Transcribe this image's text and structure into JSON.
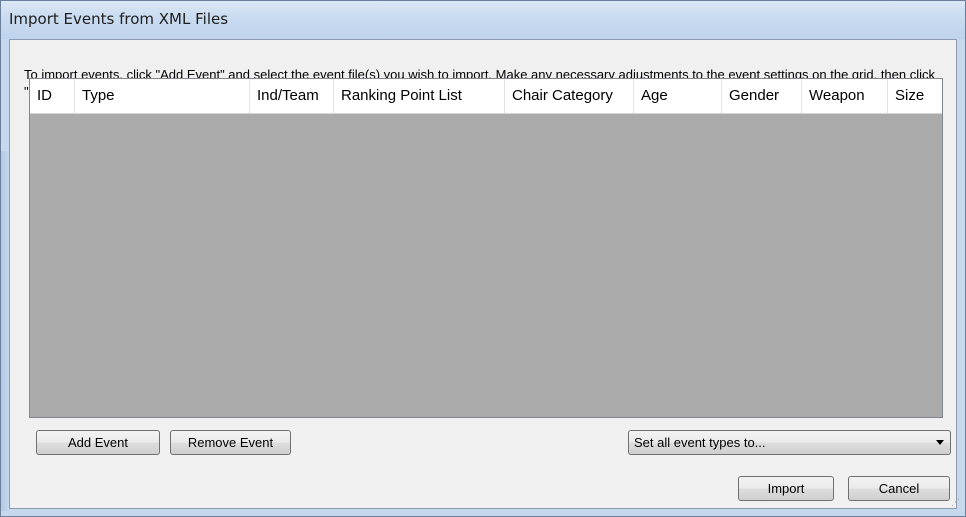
{
  "window": {
    "title": "Import Events from XML Files"
  },
  "instructions": "To import events, click \"Add Event\" and select the event file(s) you wish to import.  Make any necessary adjustments to the event settings on the grid, then click \"Import\" to finish the process.",
  "grid": {
    "columns": [
      "ID",
      "Type",
      "Ind/Team",
      "Ranking Point List",
      "Chair Category",
      "Age",
      "Gender",
      "Weapon",
      "Size"
    ],
    "rows": []
  },
  "buttons": {
    "add_event": "Add Event",
    "remove_event": "Remove Event",
    "import": "Import",
    "cancel": "Cancel"
  },
  "event_type_combo": {
    "selected": "Set all event types to..."
  },
  "colors": {
    "grid_background": "#ababab",
    "titlebar": "#c9dbf0"
  }
}
